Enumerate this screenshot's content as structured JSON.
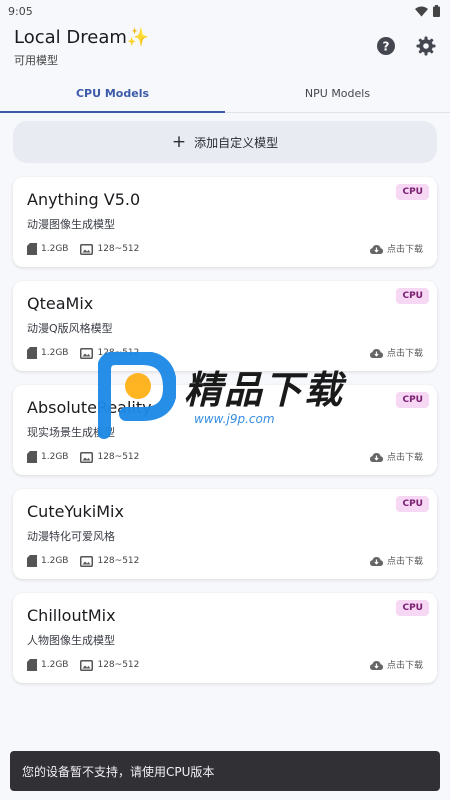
{
  "status_bar": {
    "time": "9:05"
  },
  "header": {
    "title": "Local Dream✨",
    "subtitle": "可用模型",
    "help_icon": "help-circle-icon",
    "settings_icon": "gear-icon"
  },
  "tabs": [
    {
      "label": "CPU Models",
      "active": true
    },
    {
      "label": "NPU Models",
      "active": false
    }
  ],
  "add_button": {
    "label": "添加自定义模型",
    "icon": "plus-icon"
  },
  "models": [
    {
      "name": "Anything V5.0",
      "desc": "动漫图像生成模型",
      "badge": "CPU",
      "size": "1.2GB",
      "resolution": "128~512",
      "download": "点击下载"
    },
    {
      "name": "QteaMix",
      "desc": "动漫Q版风格模型",
      "badge": "CPU",
      "size": "1.2GB",
      "resolution": "128~512",
      "download": "点击下载"
    },
    {
      "name": "AbsoluteReality",
      "desc": "现实场景生成模型",
      "badge": "CPU",
      "size": "1.2GB",
      "resolution": "128~512",
      "download": "点击下载"
    },
    {
      "name": "CuteYukiMix",
      "desc": "动漫特化可爱风格",
      "badge": "CPU",
      "size": "1.2GB",
      "resolution": "128~512",
      "download": "点击下载"
    },
    {
      "name": "ChilloutMix",
      "desc": "人物图像生成模型",
      "badge": "CPU",
      "size": "1.2GB",
      "resolution": "128~512",
      "download": "点击下载"
    }
  ],
  "snackbar": {
    "message": "您的设备暂不支持，请使用CPU版本"
  },
  "watermark": {
    "title": "精品下载",
    "url": "www.j9p.com"
  },
  "colors": {
    "accent": "#3b5ba9",
    "badge_bg": "#f6d8f5",
    "badge_text": "#7a1e73",
    "snackbar_bg": "#313035"
  }
}
